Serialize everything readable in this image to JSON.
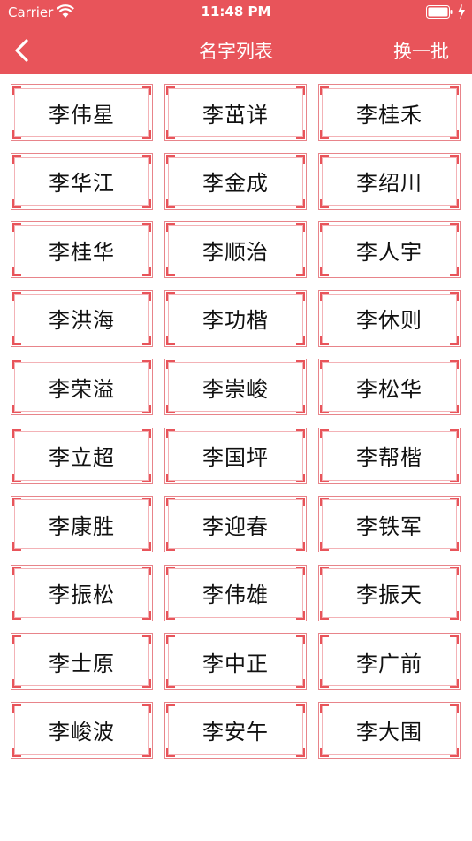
{
  "status_bar": {
    "carrier": "Carrier",
    "time": "11:48 PM",
    "icons": [
      "wifi-icon",
      "battery-icon",
      "charging-bolt-icon"
    ]
  },
  "nav": {
    "title": "名字列表",
    "back_icon": "chevron-left-icon",
    "refresh_label": "换一批"
  },
  "colors": {
    "header_bg": "#e8545a",
    "card_border": "#e8848a",
    "text": "#111111"
  },
  "names": [
    "李伟星",
    "李茁详",
    "李桂禾",
    "李华江",
    "李金成",
    "李绍川",
    "李桂华",
    "李顺治",
    "李人宇",
    "李洪海",
    "李功楷",
    "李休则",
    "李荣溢",
    "李崇峻",
    "李松华",
    "李立超",
    "李国坪",
    "李帮楷",
    "李康胜",
    "李迎春",
    "李铁军",
    "李振松",
    "李伟雄",
    "李振天",
    "李士原",
    "李中正",
    "李广前",
    "李峻波",
    "李安午",
    "李大围"
  ]
}
